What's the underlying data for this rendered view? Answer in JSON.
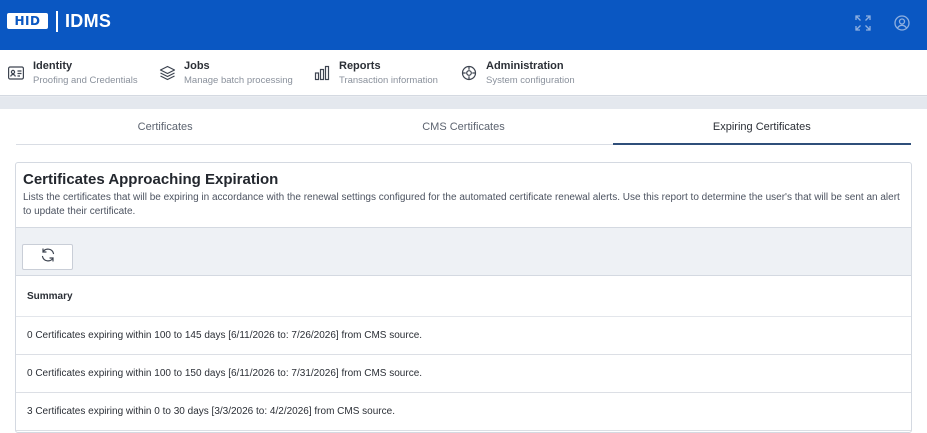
{
  "header": {
    "logo_text": "HID",
    "app_title": "IDMS",
    "fullscreen_icon": "expand-arrows-icon",
    "account_icon": "user-circle-icon",
    "colors": {
      "topbar": "#0a57c2",
      "tab_indicator": "#2f4f7a"
    }
  },
  "nav": [
    {
      "title": "Identity",
      "subtitle": "Proofing and Credentials",
      "icon": "id-card-icon"
    },
    {
      "title": "Jobs",
      "subtitle": "Manage batch processing",
      "icon": "layers-icon"
    },
    {
      "title": "Reports",
      "subtitle": "Transaction information",
      "icon": "bar-chart-icon"
    },
    {
      "title": "Administration",
      "subtitle": "System configuration",
      "icon": "settings-gear-icon"
    }
  ],
  "tabs": [
    {
      "label": "Certificates",
      "active": false
    },
    {
      "label": "CMS Certificates",
      "active": false
    },
    {
      "label": "Expiring Certificates",
      "active": true
    }
  ],
  "card": {
    "title": "Certificates Approaching Expiration",
    "description": "Lists the certificates that will be expiring in accordance with the renewal settings configured for the automated certificate renewal alerts. Use this report to determine the user's that will be sent an alert to update their certificate.",
    "refresh_icon": "refresh-icon"
  },
  "summary": {
    "header": "Summary",
    "rows": [
      "0 Certificates expiring within 100 to 145 days [6/11/2026 to: 7/26/2026] from CMS source.",
      "0 Certificates expiring within 100 to 150 days [6/11/2026 to: 7/31/2026] from CMS source.",
      "3 Certificates expiring within 0 to 30 days [3/3/2026 to: 4/2/2026] from CMS source."
    ]
  }
}
